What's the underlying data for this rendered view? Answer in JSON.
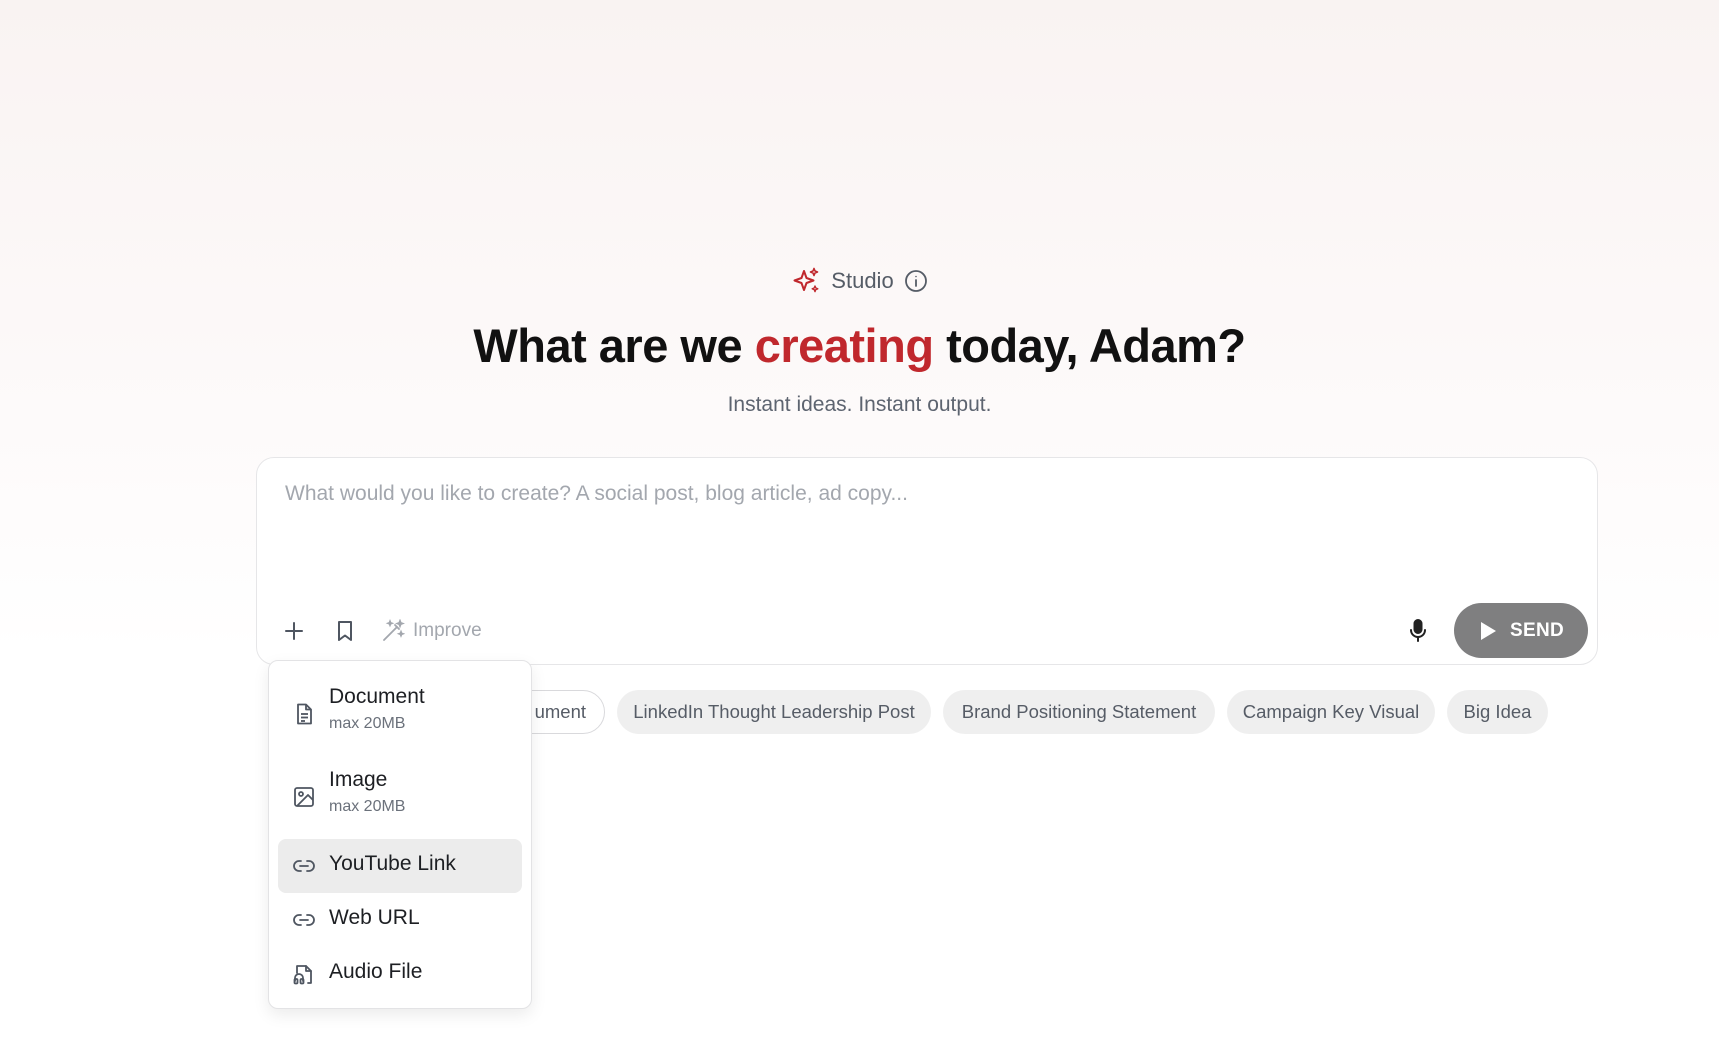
{
  "header": {
    "studio_label": "Studio",
    "accent_color": "#c0282d",
    "sparkle_icon": "sparkle-icon",
    "info_icon": "info-icon"
  },
  "hero": {
    "title_before": "What are we ",
    "title_accent": "creating",
    "title_after": " today, Adam?",
    "subtitle": "Instant ideas. Instant output."
  },
  "composer": {
    "placeholder": "What would you like to create? A social post, blog article, ad copy...",
    "value": "",
    "improve_label": "Improve",
    "send_label": "SEND",
    "send_color": "#7f7f80"
  },
  "chips": [
    {
      "label": "ument"
    },
    {
      "label": "LinkedIn Thought Leadership Post"
    },
    {
      "label": "Brand Positioning Statement"
    },
    {
      "label": "Campaign Key Visual"
    },
    {
      "label": "Big Idea"
    }
  ],
  "attach_menu": {
    "items": [
      {
        "label": "Document",
        "sublabel": "max 20MB",
        "icon": "document-icon"
      },
      {
        "label": "Image",
        "sublabel": "max 20MB",
        "icon": "image-icon"
      },
      {
        "label": "YouTube Link",
        "icon": "link-icon",
        "highlighted": true
      },
      {
        "label": "Web URL",
        "icon": "link-icon"
      },
      {
        "label": "Audio File",
        "icon": "audio-file-icon"
      }
    ]
  }
}
